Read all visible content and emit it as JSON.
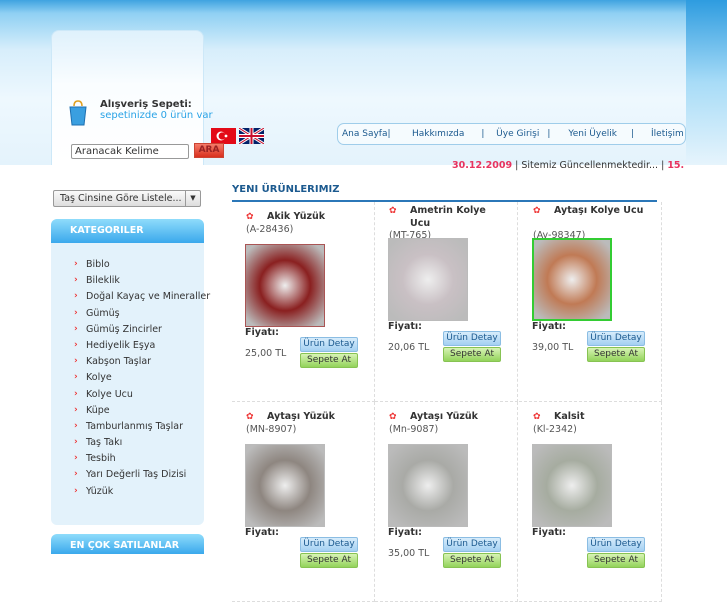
{
  "cart": {
    "title": "Alışveriş Sepeti:",
    "status": "sepetinizde 0 ürün var"
  },
  "search": {
    "placeholder": "Aranacak Kelime",
    "button": "ARA"
  },
  "languages": [
    "Türkçe",
    "English"
  ],
  "nav": [
    "Ana Sayfa",
    "Hakkımızda",
    "Üye Girişi",
    "Yeni Üyelik",
    "İletişim"
  ],
  "ticker": {
    "date": "30.12.2009",
    "text": "Sitemiz Güncellenmektedir...",
    "next": "15."
  },
  "filter": {
    "selected": "Taş Cinsine Göre Listele..."
  },
  "categories": {
    "title": "KATEGORILER",
    "items": [
      "Biblo",
      "Bileklik",
      "Doğal Kayaç ve Mineraller",
      "Gümüş",
      "Gümüş Zincirler",
      "Hediyelik Eşya",
      "Kabşon Taşlar",
      "Kolye",
      "Kolye Ucu",
      "Küpe",
      "Tamburlanmış Taşlar",
      "Taş Takı",
      "Tesbih",
      "Yarı Değerli Taş Dizisi",
      "Yüzük"
    ]
  },
  "bestsellers": {
    "title": "EN ÇOK SATILANLAR"
  },
  "section_title": "YENI ÜRÜNLERIMIZ",
  "labels": {
    "price": "Fiyatı:",
    "detail": "Ürün Detay",
    "add": "Sepete At"
  },
  "products": [
    {
      "name": "Akik Yüzük",
      "code": "(A-28436)",
      "price": "25,00 TL",
      "img": "#8a2020"
    },
    {
      "name": "Ametrin Kolye Ucu",
      "code": "(MT-765)",
      "price": "20,06 TL",
      "img": "#c9c0c4"
    },
    {
      "name": "Aytaşı Kolye Ucu",
      "code": "(Ay-98347)",
      "price": "39,00 TL",
      "img": "#c07a55"
    },
    {
      "name": "Aytaşı Yüzük",
      "code": "(MN-8907)",
      "price": "",
      "img": "#8e8680"
    },
    {
      "name": "Aytaşı Yüzük",
      "code": "(Mn-9087)",
      "price": "35,00 TL",
      "img": "#a9aaa6"
    },
    {
      "name": "Kalsit",
      "code": "(Kl-2342)",
      "price": "",
      "img": "#a6aca0"
    }
  ]
}
